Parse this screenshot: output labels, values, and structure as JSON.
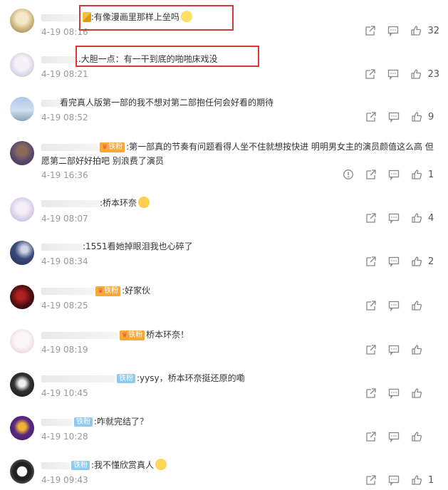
{
  "comments": [
    {
      "text": ":有像漫画里那样上垒吗",
      "time": "4-19 08:16",
      "likes": "32",
      "badge": "",
      "badge_style": "",
      "emoji": "lol",
      "lead_emoji": "flag"
    },
    {
      "text": "..大胆一点：有一干到底的啪啪床戏没",
      "time": "4-19 08:21",
      "likes": "23",
      "badge": "",
      "badge_style": "",
      "emoji": "",
      "lead_emoji": ""
    },
    {
      "text": "看完真人版第一部的我不想对第二部抱任何会好看的期待",
      "time": "4-19 08:52",
      "likes": "9",
      "badge": "",
      "badge_style": "",
      "emoji": "",
      "lead_emoji": ""
    },
    {
      "text": ":第一部真的节奏有问题看得人坐不住就想按快进 明明男女主的演员颜值这么高 但愿第二部好好拍吧 别浪费了演员",
      "time": "4-19 16:36",
      "likes": "1",
      "badge": "铁粉",
      "badge_style": "orange crown",
      "emoji": "",
      "lead_emoji": ""
    },
    {
      "text": ":桥本环奈",
      "time": "4-19 08:07",
      "likes": "4",
      "badge": "",
      "badge_style": "",
      "emoji": "love",
      "lead_emoji": ""
    },
    {
      "text": ":1551看她掉眼泪我也心碎了",
      "time": "4-19 08:34",
      "likes": "2",
      "badge": "",
      "badge_style": "",
      "emoji": "",
      "lead_emoji": ""
    },
    {
      "text": ":好家伙",
      "time": "4-19 08:25",
      "likes": "",
      "badge": "铁粉",
      "badge_style": "orange crown",
      "emoji": "",
      "lead_emoji": ""
    },
    {
      "text": "桥本环奈！",
      "time": "4-19 08:19",
      "likes": "",
      "badge": "铁粉",
      "badge_style": "orange crown",
      "emoji": "",
      "lead_emoji": ""
    },
    {
      "text": ":yysy，桥本环奈挺还原的嘞",
      "time": "4-19 10:45",
      "likes": "",
      "badge": "铁粉",
      "badge_style": "blue",
      "emoji": "",
      "lead_emoji": ""
    },
    {
      "text": ":咋就完结了？",
      "time": "4-19 10:28",
      "likes": "",
      "badge": "铁粉",
      "badge_style": "blue",
      "emoji": "",
      "lead_emoji": ""
    },
    {
      "text": ":我不懂欣赏真人",
      "time": "4-19 09:43",
      "likes": "1",
      "badge": "铁粉",
      "badge_style": "blue",
      "emoji": "laugh",
      "lead_emoji": ""
    }
  ],
  "colors": {
    "highlight_box": "#d9383a",
    "badge_blue": "#8fc9ee",
    "badge_orange": "#f7a83b",
    "time_text": "#999999"
  },
  "icons": {
    "share": "share-icon",
    "comment": "comment-icon",
    "like": "thumb-up-icon",
    "report": "report-icon"
  }
}
